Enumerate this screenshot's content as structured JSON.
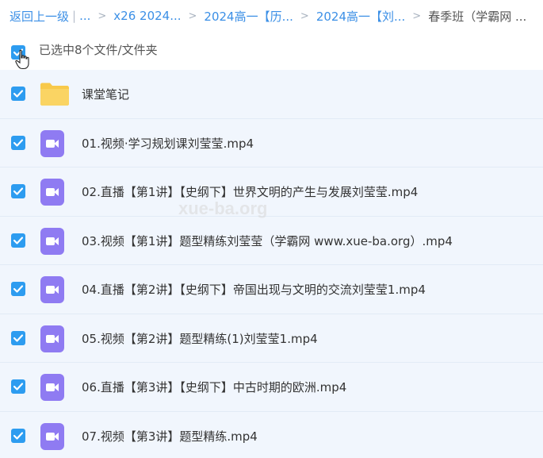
{
  "breadcrumb": {
    "back_label": "返回上一级",
    "ellipsis": "...",
    "items": [
      "x26 2024...",
      "2024高一【历...",
      "2024高一【刘..."
    ],
    "current": "春季班（学霸网 ..."
  },
  "selection": {
    "text": "已选中8个文件/文件夹"
  },
  "files": [
    {
      "name": "课堂笔记",
      "type": "folder"
    },
    {
      "name": "01.视频·学习规划课刘莹莹.mp4",
      "type": "video"
    },
    {
      "name": "02.直播【第1讲】【史纲下】世界文明的产生与发展刘莹莹.mp4",
      "type": "video"
    },
    {
      "name": "03.视频【第1讲】题型精练刘莹莹（学霸网 www.xue-ba.org）.mp4",
      "type": "video"
    },
    {
      "name": "04.直播【第2讲】【史纲下】帝国出现与文明的交流刘莹莹1.mp4",
      "type": "video"
    },
    {
      "name": "05.视频【第2讲】题型精练(1)刘莹莹1.mp4",
      "type": "video"
    },
    {
      "name": "06.直播【第3讲】【史纲下】中古时期的欧洲.mp4",
      "type": "video"
    },
    {
      "name": "07.视频【第3讲】题型精练.mp4",
      "type": "video"
    }
  ],
  "watermark": "xue-ba.org",
  "colors": {
    "accent": "#2d9cf0",
    "link": "#3b8fe6",
    "row_bg": "#f1f6fd",
    "video_icon": "#8f7bf2",
    "folder_icon": "#f8c94a"
  }
}
